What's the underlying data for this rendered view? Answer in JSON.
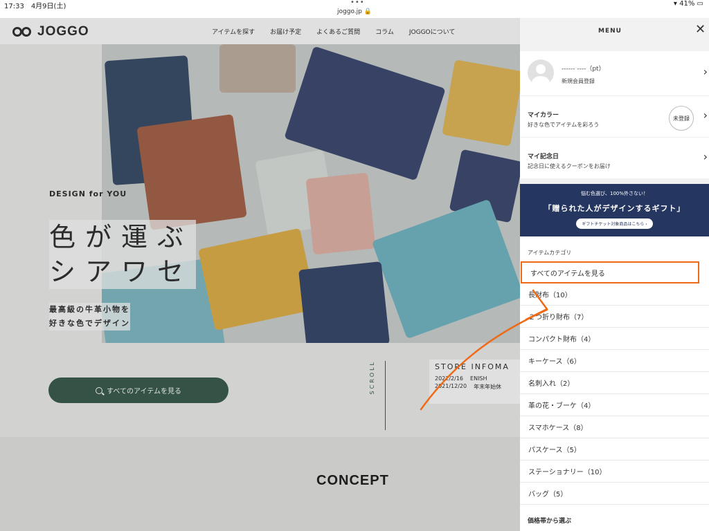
{
  "statusbar": {
    "time": "17:33　4月9日(土)",
    "url": "joggo.jp 🔒",
    "battery": "41%"
  },
  "site": {
    "logo": "JOGGO",
    "nav": [
      "アイテムを探す",
      "お届け予定",
      "よくあるご質問",
      "コラム",
      "JOGGOについて"
    ],
    "design_for": "DESIGN for YOU",
    "catch_line1": "色が運ぶ",
    "catch_line2": "シアワセ",
    "sub_line1": "最高級の牛革小物を",
    "sub_line2": "好きな色でデザイン",
    "cta_label": "すべてのアイテムを見る",
    "scroll_label": "SCROLL",
    "store_title": "STORE INFOMA",
    "store_rows": [
      {
        "date": "2022/2/16",
        "text": "ENISH"
      },
      {
        "date": "2021/12/20",
        "text": "年末年始休"
      }
    ],
    "concept": "CONCEPT"
  },
  "drawer": {
    "title": "MENU",
    "member_name": "------ ----（pt）",
    "member_register": "新規会員登録",
    "my_color_title": "マイカラー",
    "my_color_desc": "好きな色でアイテムを彩ろう",
    "my_color_badge": "未登録",
    "anniv_title": "マイ記念日",
    "anniv_desc": "記念日に使えるクーポンをお届け",
    "banner_line1": "悩む色選び、100%外さない！",
    "banner_line2": "「贈られた人がデザインするギフト」",
    "banner_button": "ギフトチケット対象商品はこちら ›",
    "category_label": "アイテムカテゴリ",
    "categories": [
      "すべてのアイテムを見る",
      "長財布（10）",
      "２つ折り財布（7）",
      "コンパクト財布（4）",
      "キーケース（6）",
      "名刺入れ（2）",
      "革の花・ブーケ（4）",
      "スマホケース（8）",
      "パスケース（5）",
      "ステーショナリー（10）",
      "バッグ（5）"
    ],
    "price_label": "価格帯から選ぶ"
  },
  "colors": {
    "accent_green": "#3c5e50",
    "highlight_orange": "#ef6a16",
    "banner_navy": "#253660"
  }
}
